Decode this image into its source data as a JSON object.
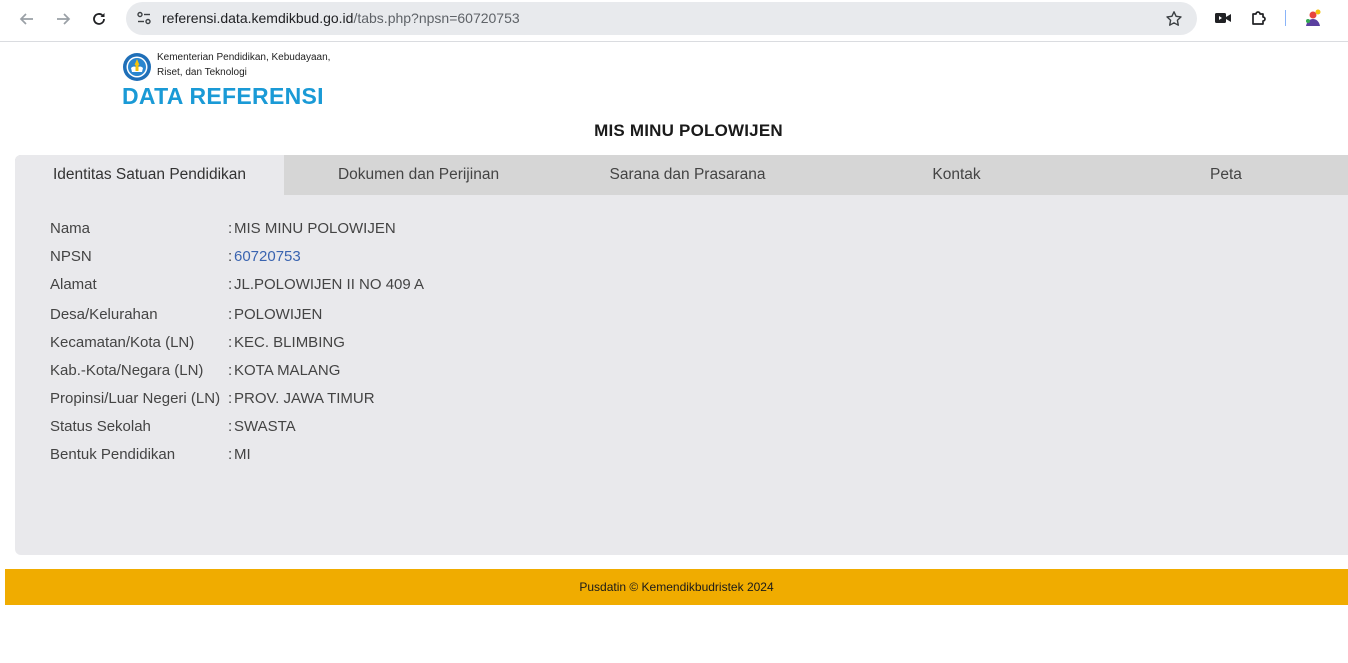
{
  "browser": {
    "url_host": "referensi.data.kemdikbud.go.id",
    "url_path": "/tabs.php?npsn=60720753",
    "back_icon": "arrow-left-icon",
    "forward_icon": "arrow-right-icon",
    "reload_icon": "reload-icon",
    "star_icon": "star-icon"
  },
  "header": {
    "ministry_line1": "Kementerian Pendidikan, Kebudayaan,",
    "ministry_line2": "Riset, dan Teknologi",
    "app_title": "DATA REFERENSI"
  },
  "page": {
    "title": "MIS MINU POLOWIJEN"
  },
  "tabs": [
    {
      "label": "Identitas Satuan Pendidikan",
      "active": true
    },
    {
      "label": "Dokumen dan Perijinan",
      "active": false
    },
    {
      "label": "Sarana dan Prasarana",
      "active": false
    },
    {
      "label": "Kontak",
      "active": false
    },
    {
      "label": "Peta",
      "active": false
    }
  ],
  "identity": [
    {
      "label": "Nama",
      "value": "MIS MINU POLOWIJEN"
    },
    {
      "label": "NPSN",
      "value": "60720753"
    },
    {
      "label": "Alamat",
      "value": "JL.POLOWIJEN II NO 409 A"
    },
    {
      "label": "Desa/Kelurahan",
      "value": "POLOWIJEN"
    },
    {
      "label": "Kecamatan/Kota (LN)",
      "value": "KEC. BLIMBING"
    },
    {
      "label": "Kab.-Kota/Negara (LN)",
      "value": "KOTA MALANG"
    },
    {
      "label": "Propinsi/Luar Negeri (LN)",
      "value": "PROV. JAWA TIMUR"
    },
    {
      "label": "Status Sekolah",
      "value": "SWASTA"
    },
    {
      "label": "Bentuk Pendidikan",
      "value": "MI"
    }
  ],
  "colon": ":",
  "footer": {
    "text": "Pusdatin © Kemendikbudristek 2024"
  },
  "colors": {
    "accent_title": "#1a9ad6",
    "footer_bg": "#f0ac00",
    "link": "#3a64b0"
  }
}
